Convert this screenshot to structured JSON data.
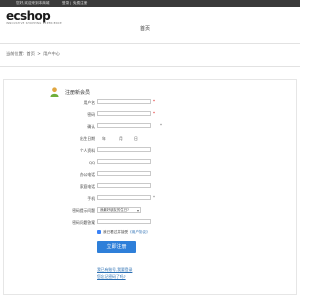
{
  "topbar": {
    "left_text": "您好,欢迎来到本商城",
    "login": "登录",
    "separator": "|",
    "register": "免费注册"
  },
  "header": {
    "logo": "ecshop",
    "logo_sub": "INNOVATIVE SHOPPING EXPERIENCE",
    "title": "首页"
  },
  "breadcrumb": {
    "label": "当前位置:",
    "home": "首页",
    "sep": ">",
    "current": "用户中心"
  },
  "form": {
    "title": "注册新会员",
    "fields": {
      "username": {
        "label": "用户名",
        "value": ""
      },
      "password": {
        "label": "密码",
        "value": ""
      },
      "confirm": {
        "label": "确认",
        "value": ""
      },
      "birthday": {
        "label": "出生日期",
        "year": "年",
        "month": "月",
        "day": "日"
      },
      "gender": {
        "label": "个人资料",
        "value": ""
      },
      "qq": {
        "label": "QQ",
        "value": ""
      },
      "office_phone": {
        "label": "办公电话",
        "value": ""
      },
      "home_phone": {
        "label": "家庭电话",
        "value": ""
      },
      "mobile": {
        "label": "手机",
        "value": ""
      },
      "password_question": {
        "label": "密码提示问题",
        "selected": "我最好朋友的生日?"
      },
      "password_answer": {
        "label": "密码问题答案",
        "value": ""
      }
    },
    "agree": {
      "text": "我已看过并接受",
      "link": "《用户协议》"
    },
    "submit": "立即注册",
    "links": [
      "我已有账号,我要登录",
      "您忘记密码了吗?"
    ]
  },
  "colors": {
    "topbar": "#3a3a3a",
    "accent": "#2e7fd9",
    "required": "#dd0000"
  },
  "icons": [
    "user-icon"
  ]
}
